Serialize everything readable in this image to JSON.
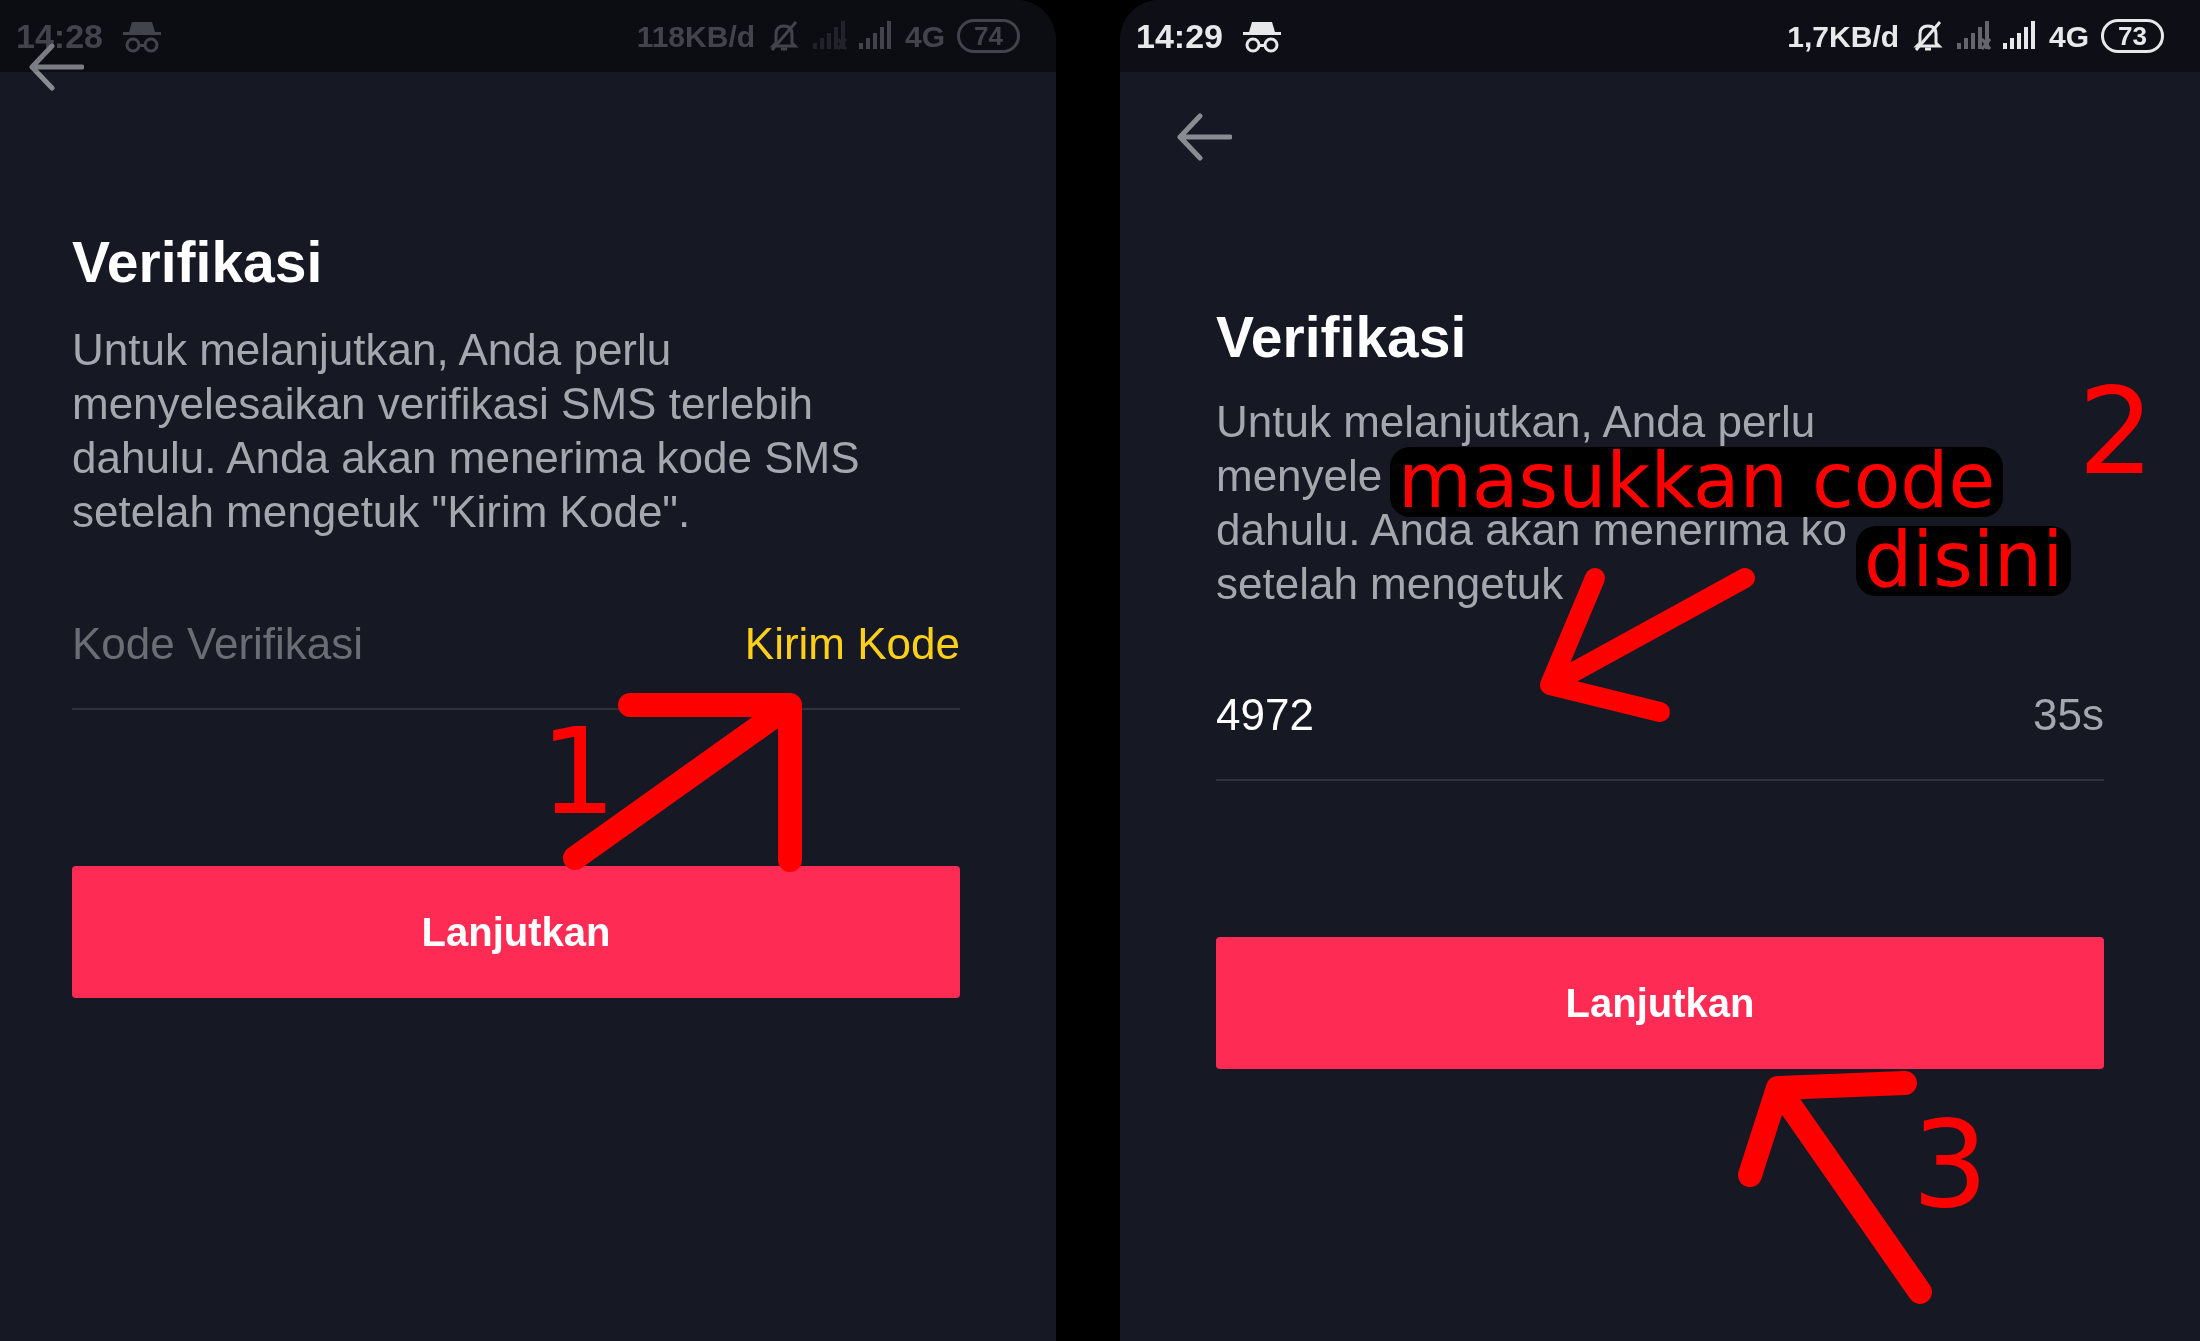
{
  "panels": [
    {
      "dimmed": true,
      "status_bar": {
        "time": "14:28",
        "network_speed": "118KB/d",
        "network": "4G",
        "battery": "74"
      },
      "title": "Verifikasi",
      "description_lines": [
        "Untuk melanjutkan, Anda perlu",
        "menyelesaikan verifikasi SMS terlebih",
        "dahulu. Anda akan menerima kode SMS",
        "setelah mengetuk \"Kirim Kode\"."
      ],
      "field": {
        "placeholder": "Kode Verifikasi"
      },
      "trailing": {
        "kind": "link",
        "text": "Kirim Kode"
      },
      "button": "Lanjutkan"
    },
    {
      "dimmed": false,
      "status_bar": {
        "time": "14:29",
        "network_speed": "1,7KB/d",
        "network": "4G",
        "battery": "73"
      },
      "title": "Verifikasi",
      "description_lines": [
        "Untuk melanjutkan, Anda perlu",
        "menyele",
        "dahulu. Anda akan menerima ko",
        "setelah mengetuk"
      ],
      "field": {
        "value": "4972"
      },
      "trailing": {
        "kind": "timer",
        "text": "35s"
      },
      "button": "Lanjutkan"
    }
  ],
  "annotations": [
    {
      "kind": "step",
      "text": "1"
    },
    {
      "kind": "step",
      "text": "2"
    },
    {
      "kind": "label",
      "text": "masukkan code"
    },
    {
      "kind": "label",
      "text": "disini"
    },
    {
      "kind": "step",
      "text": "3"
    }
  ]
}
